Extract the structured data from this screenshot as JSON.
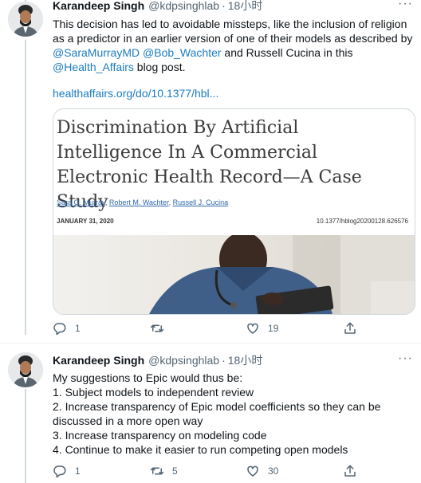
{
  "tweets": [
    {
      "name": "Karandeep Singh",
      "handle": "@kdpsinghlab",
      "dot": "·",
      "time": "18小时",
      "text_parts": [
        "This decision has led to avoidable missteps, like the inclusion of religion as a predictor in an earlier version of one of their models as described by ",
        "@SaraMurrayMD",
        " ",
        "@Bob_Wachter",
        " and Russell Cucina in this ",
        "@Health_Affairs",
        " blog post."
      ],
      "url": "healthaffairs.org/do/10.1377/hbl...",
      "card": {
        "title": "Discrimination By Artificial Intelligence In A Commercial Electronic Health Record—A Case Study",
        "authors": [
          "Sara G. Murray",
          "Robert M. Wachter",
          "Russell J. Cucina"
        ],
        "author_sep": ", ",
        "date": "JANUARY 31, 2020",
        "doi": "10.1377/hblog20200128.626576"
      },
      "actions": {
        "reply_count": "1",
        "retweet_count": "",
        "like_count": "19"
      }
    },
    {
      "name": "Karandeep Singh",
      "handle": "@kdpsinghlab",
      "dot": "·",
      "time": "18小时",
      "lines": [
        "My suggestions to Epic would thus be:",
        "1. Subject models to independent review",
        "2. Increase transparency of Epic model coefficients so they can be discussed in a more open way",
        "3. Increase transparency on modeling code",
        "4. Continue to make it easier to run competing open models"
      ],
      "actions": {
        "reply_count": "1",
        "retweet_count": "5",
        "like_count": "30"
      }
    }
  ],
  "more_glyph": "···",
  "colors": {
    "link": "#1b7cc1",
    "muted": "#536471",
    "text": "#0f1419",
    "thread": "#cfd9de"
  },
  "icons": [
    "avatar",
    "more-icon",
    "reply-icon",
    "retweet-icon",
    "like-icon",
    "share-icon"
  ]
}
